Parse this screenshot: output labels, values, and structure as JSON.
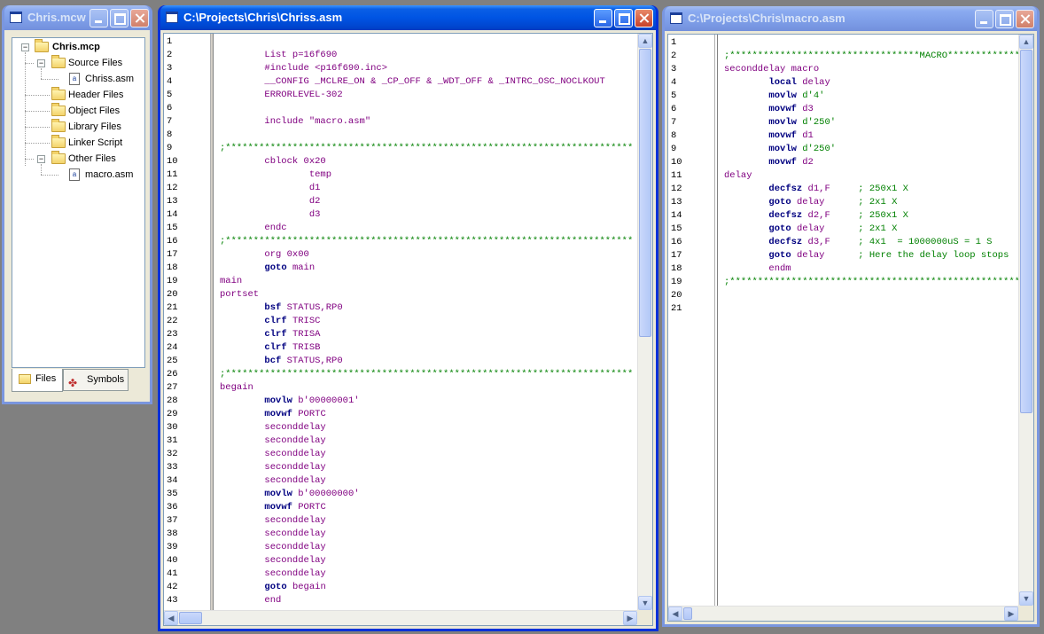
{
  "project_window": {
    "title": "Chris.mcw",
    "tree": {
      "root": "Chris.mcp",
      "source_files": "Source Files",
      "source_file_1": "Chriss.asm",
      "header_files": "Header Files",
      "object_files": "Object Files",
      "library_files": "Library Files",
      "linker_script": "Linker Script",
      "other_files": "Other Files",
      "other_file_1": "macro.asm"
    },
    "tabs": {
      "files": "Files",
      "symbols": "Symbols"
    }
  },
  "editor_main": {
    "title": "C:\\Projects\\Chris\\Chriss.asm",
    "lines": [
      "",
      "        List p=16f690",
      "        #include <p16f690.inc>",
      "        __CONFIG _MCLRE_ON & _CP_OFF & _WDT_OFF & _INTRC_OSC_NOCLKOUT",
      "        ERRORLEVEL-302",
      "",
      "        include \"macro.asm\"",
      "",
      ";*************************************************************************",
      "        cblock 0x20",
      "                temp",
      "                d1",
      "                d2",
      "                d3",
      "        endc",
      ";*************************************************************************",
      "        org 0x00",
      "        goto main",
      "main",
      "portset",
      "        bsf STATUS,RP0",
      "        clrf TRISC",
      "        clrf TRISA",
      "        clrf TRISB",
      "        bcf STATUS,RP0",
      ";*************************************************************************",
      "begain",
      "        movlw b'00000001'",
      "        movwf PORTC",
      "        seconddelay",
      "        seconddelay",
      "        seconddelay",
      "        seconddelay",
      "        seconddelay",
      "        movlw b'00000000'",
      "        movwf PORTC",
      "        seconddelay",
      "        seconddelay",
      "        seconddelay",
      "        seconddelay",
      "        seconddelay",
      "        goto begain",
      "        end"
    ]
  },
  "editor_macro": {
    "title": "C:\\Projects\\Chris\\macro.asm",
    "lines": [
      "",
      ";**********************************MACRO*********************************",
      "seconddelay macro",
      "        local delay",
      "        movlw d'4'",
      "        movwf d3",
      "        movlw d'250'",
      "        movwf d1",
      "        movlw d'250'",
      "        movwf d2",
      "delay",
      "        decfsz d1,F     ; 250x1 X",
      "        goto delay      ; 2x1 X",
      "        decfsz d2,F     ; 250x1 X",
      "        goto delay      ; 2x1 X",
      "        decfsz d3,F     ; 4x1  = 1000000uS = 1 S",
      "        goto delay      ; Here the delay loop stops",
      "        endm",
      ";*************************************************************************",
      "",
      ""
    ]
  },
  "colors": {
    "active_title": "#0054e3",
    "inactive_title": "#7e9ee8",
    "keyword": "#000080",
    "directive": "#800080",
    "comment": "#008000"
  }
}
